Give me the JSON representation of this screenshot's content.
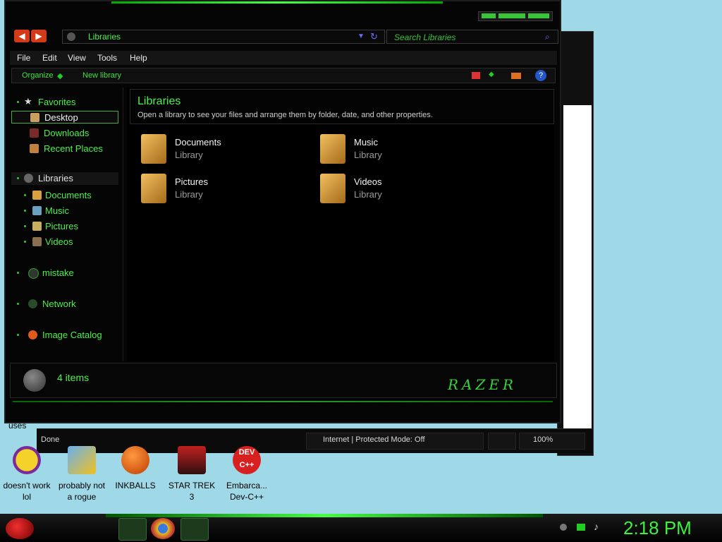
{
  "explorer": {
    "address": "Libraries",
    "search_placeholder": "Search Libraries",
    "menu": [
      "File",
      "Edit",
      "View",
      "Tools",
      "Help"
    ],
    "toolbar": {
      "organize": "Organize",
      "new_library": "New library"
    },
    "nav": {
      "favorites": "Favorites",
      "desktop": "Desktop",
      "downloads": "Downloads",
      "recent": "Recent Places",
      "libraries": "Libraries",
      "documents": "Documents",
      "music": "Music",
      "pictures": "Pictures",
      "videos": "Videos",
      "mistake": "mistake",
      "network": "Network",
      "image_catalog": "Image Catalog"
    },
    "header": {
      "title": "Libraries",
      "subtitle": "Open a library to see your files and arrange them by folder, date, and other properties."
    },
    "libraries": [
      {
        "name": "Documents",
        "kind": "Library"
      },
      {
        "name": "Music",
        "kind": "Library"
      },
      {
        "name": "Pictures",
        "kind": "Library"
      },
      {
        "name": "Videos",
        "kind": "Library"
      }
    ],
    "details": {
      "count": "4 items",
      "brand": "RAZER"
    }
  },
  "ie": {
    "status": "Done",
    "zone": "Internet | Protected Mode: Off",
    "zoom": "100%"
  },
  "desktop": {
    "partial_label": "uses",
    "icons": [
      {
        "label1": "doesn't work",
        "label2": "lol"
      },
      {
        "label1": "probably not",
        "label2": "a rogue"
      },
      {
        "label1": "INKBALLS",
        "label2": ""
      },
      {
        "label1": "STAR TREK",
        "label2": "3"
      },
      {
        "label1": "Embarca...",
        "label2": "Dev-C++"
      }
    ]
  },
  "taskbar": {
    "clock": "2:18 PM"
  },
  "colors": {
    "accent": "#4cf04c",
    "bg": "#050505",
    "desktop": "#9fd8e6"
  }
}
